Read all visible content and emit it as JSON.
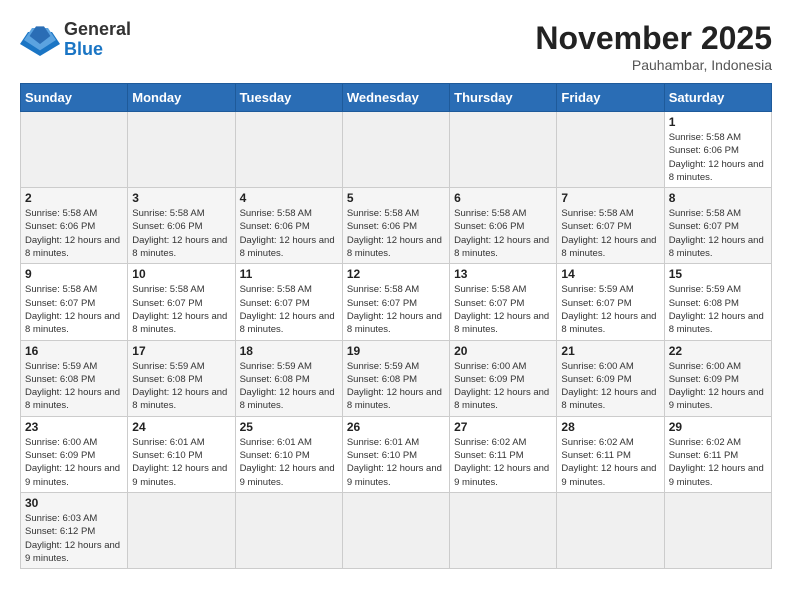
{
  "header": {
    "logo_general": "General",
    "logo_blue": "Blue",
    "title": "November 2025",
    "subtitle": "Pauhambar, Indonesia"
  },
  "weekdays": [
    "Sunday",
    "Monday",
    "Tuesday",
    "Wednesday",
    "Thursday",
    "Friday",
    "Saturday"
  ],
  "weeks": [
    [
      {
        "day": "",
        "info": ""
      },
      {
        "day": "",
        "info": ""
      },
      {
        "day": "",
        "info": ""
      },
      {
        "day": "",
        "info": ""
      },
      {
        "day": "",
        "info": ""
      },
      {
        "day": "",
        "info": ""
      },
      {
        "day": "1",
        "info": "Sunrise: 5:58 AM\nSunset: 6:06 PM\nDaylight: 12 hours and 8 minutes."
      }
    ],
    [
      {
        "day": "2",
        "info": "Sunrise: 5:58 AM\nSunset: 6:06 PM\nDaylight: 12 hours and 8 minutes."
      },
      {
        "day": "3",
        "info": "Sunrise: 5:58 AM\nSunset: 6:06 PM\nDaylight: 12 hours and 8 minutes."
      },
      {
        "day": "4",
        "info": "Sunrise: 5:58 AM\nSunset: 6:06 PM\nDaylight: 12 hours and 8 minutes."
      },
      {
        "day": "5",
        "info": "Sunrise: 5:58 AM\nSunset: 6:06 PM\nDaylight: 12 hours and 8 minutes."
      },
      {
        "day": "6",
        "info": "Sunrise: 5:58 AM\nSunset: 6:06 PM\nDaylight: 12 hours and 8 minutes."
      },
      {
        "day": "7",
        "info": "Sunrise: 5:58 AM\nSunset: 6:07 PM\nDaylight: 12 hours and 8 minutes."
      },
      {
        "day": "8",
        "info": "Sunrise: 5:58 AM\nSunset: 6:07 PM\nDaylight: 12 hours and 8 minutes."
      }
    ],
    [
      {
        "day": "9",
        "info": "Sunrise: 5:58 AM\nSunset: 6:07 PM\nDaylight: 12 hours and 8 minutes."
      },
      {
        "day": "10",
        "info": "Sunrise: 5:58 AM\nSunset: 6:07 PM\nDaylight: 12 hours and 8 minutes."
      },
      {
        "day": "11",
        "info": "Sunrise: 5:58 AM\nSunset: 6:07 PM\nDaylight: 12 hours and 8 minutes."
      },
      {
        "day": "12",
        "info": "Sunrise: 5:58 AM\nSunset: 6:07 PM\nDaylight: 12 hours and 8 minutes."
      },
      {
        "day": "13",
        "info": "Sunrise: 5:58 AM\nSunset: 6:07 PM\nDaylight: 12 hours and 8 minutes."
      },
      {
        "day": "14",
        "info": "Sunrise: 5:59 AM\nSunset: 6:07 PM\nDaylight: 12 hours and 8 minutes."
      },
      {
        "day": "15",
        "info": "Sunrise: 5:59 AM\nSunset: 6:08 PM\nDaylight: 12 hours and 8 minutes."
      }
    ],
    [
      {
        "day": "16",
        "info": "Sunrise: 5:59 AM\nSunset: 6:08 PM\nDaylight: 12 hours and 8 minutes."
      },
      {
        "day": "17",
        "info": "Sunrise: 5:59 AM\nSunset: 6:08 PM\nDaylight: 12 hours and 8 minutes."
      },
      {
        "day": "18",
        "info": "Sunrise: 5:59 AM\nSunset: 6:08 PM\nDaylight: 12 hours and 8 minutes."
      },
      {
        "day": "19",
        "info": "Sunrise: 5:59 AM\nSunset: 6:08 PM\nDaylight: 12 hours and 8 minutes."
      },
      {
        "day": "20",
        "info": "Sunrise: 6:00 AM\nSunset: 6:09 PM\nDaylight: 12 hours and 8 minutes."
      },
      {
        "day": "21",
        "info": "Sunrise: 6:00 AM\nSunset: 6:09 PM\nDaylight: 12 hours and 8 minutes."
      },
      {
        "day": "22",
        "info": "Sunrise: 6:00 AM\nSunset: 6:09 PM\nDaylight: 12 hours and 9 minutes."
      }
    ],
    [
      {
        "day": "23",
        "info": "Sunrise: 6:00 AM\nSunset: 6:09 PM\nDaylight: 12 hours and 9 minutes."
      },
      {
        "day": "24",
        "info": "Sunrise: 6:01 AM\nSunset: 6:10 PM\nDaylight: 12 hours and 9 minutes."
      },
      {
        "day": "25",
        "info": "Sunrise: 6:01 AM\nSunset: 6:10 PM\nDaylight: 12 hours and 9 minutes."
      },
      {
        "day": "26",
        "info": "Sunrise: 6:01 AM\nSunset: 6:10 PM\nDaylight: 12 hours and 9 minutes."
      },
      {
        "day": "27",
        "info": "Sunrise: 6:02 AM\nSunset: 6:11 PM\nDaylight: 12 hours and 9 minutes."
      },
      {
        "day": "28",
        "info": "Sunrise: 6:02 AM\nSunset: 6:11 PM\nDaylight: 12 hours and 9 minutes."
      },
      {
        "day": "29",
        "info": "Sunrise: 6:02 AM\nSunset: 6:11 PM\nDaylight: 12 hours and 9 minutes."
      }
    ],
    [
      {
        "day": "30",
        "info": "Sunrise: 6:03 AM\nSunset: 6:12 PM\nDaylight: 12 hours and 9 minutes."
      },
      {
        "day": "",
        "info": ""
      },
      {
        "day": "",
        "info": ""
      },
      {
        "day": "",
        "info": ""
      },
      {
        "day": "",
        "info": ""
      },
      {
        "day": "",
        "info": ""
      },
      {
        "day": "",
        "info": ""
      }
    ]
  ]
}
